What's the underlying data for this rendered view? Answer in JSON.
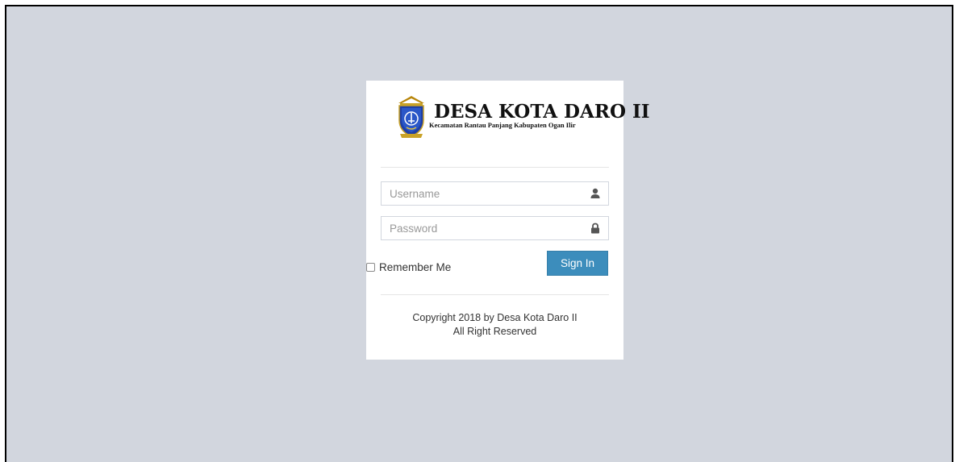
{
  "brand": {
    "title": "DESA KOTA DARO II",
    "subtitle": "Kecamatan Rantau Panjang Kabupaten Ogan Ilir",
    "emblem_icon": "regency-emblem-logo"
  },
  "form": {
    "username": {
      "placeholder": "Username",
      "value": "",
      "icon": "user-icon"
    },
    "password": {
      "placeholder": "Password",
      "value": "",
      "icon": "lock-icon"
    },
    "remember_label": "Remember Me",
    "remember_checked": false,
    "submit_label": "Sign In"
  },
  "footer": {
    "line1": "Copyright 2018 by Desa Kota Daro II",
    "line2": "All Right Reserved"
  },
  "colors": {
    "background": "#d2d6de",
    "card": "#ffffff",
    "primary": "#3c8dbc"
  }
}
